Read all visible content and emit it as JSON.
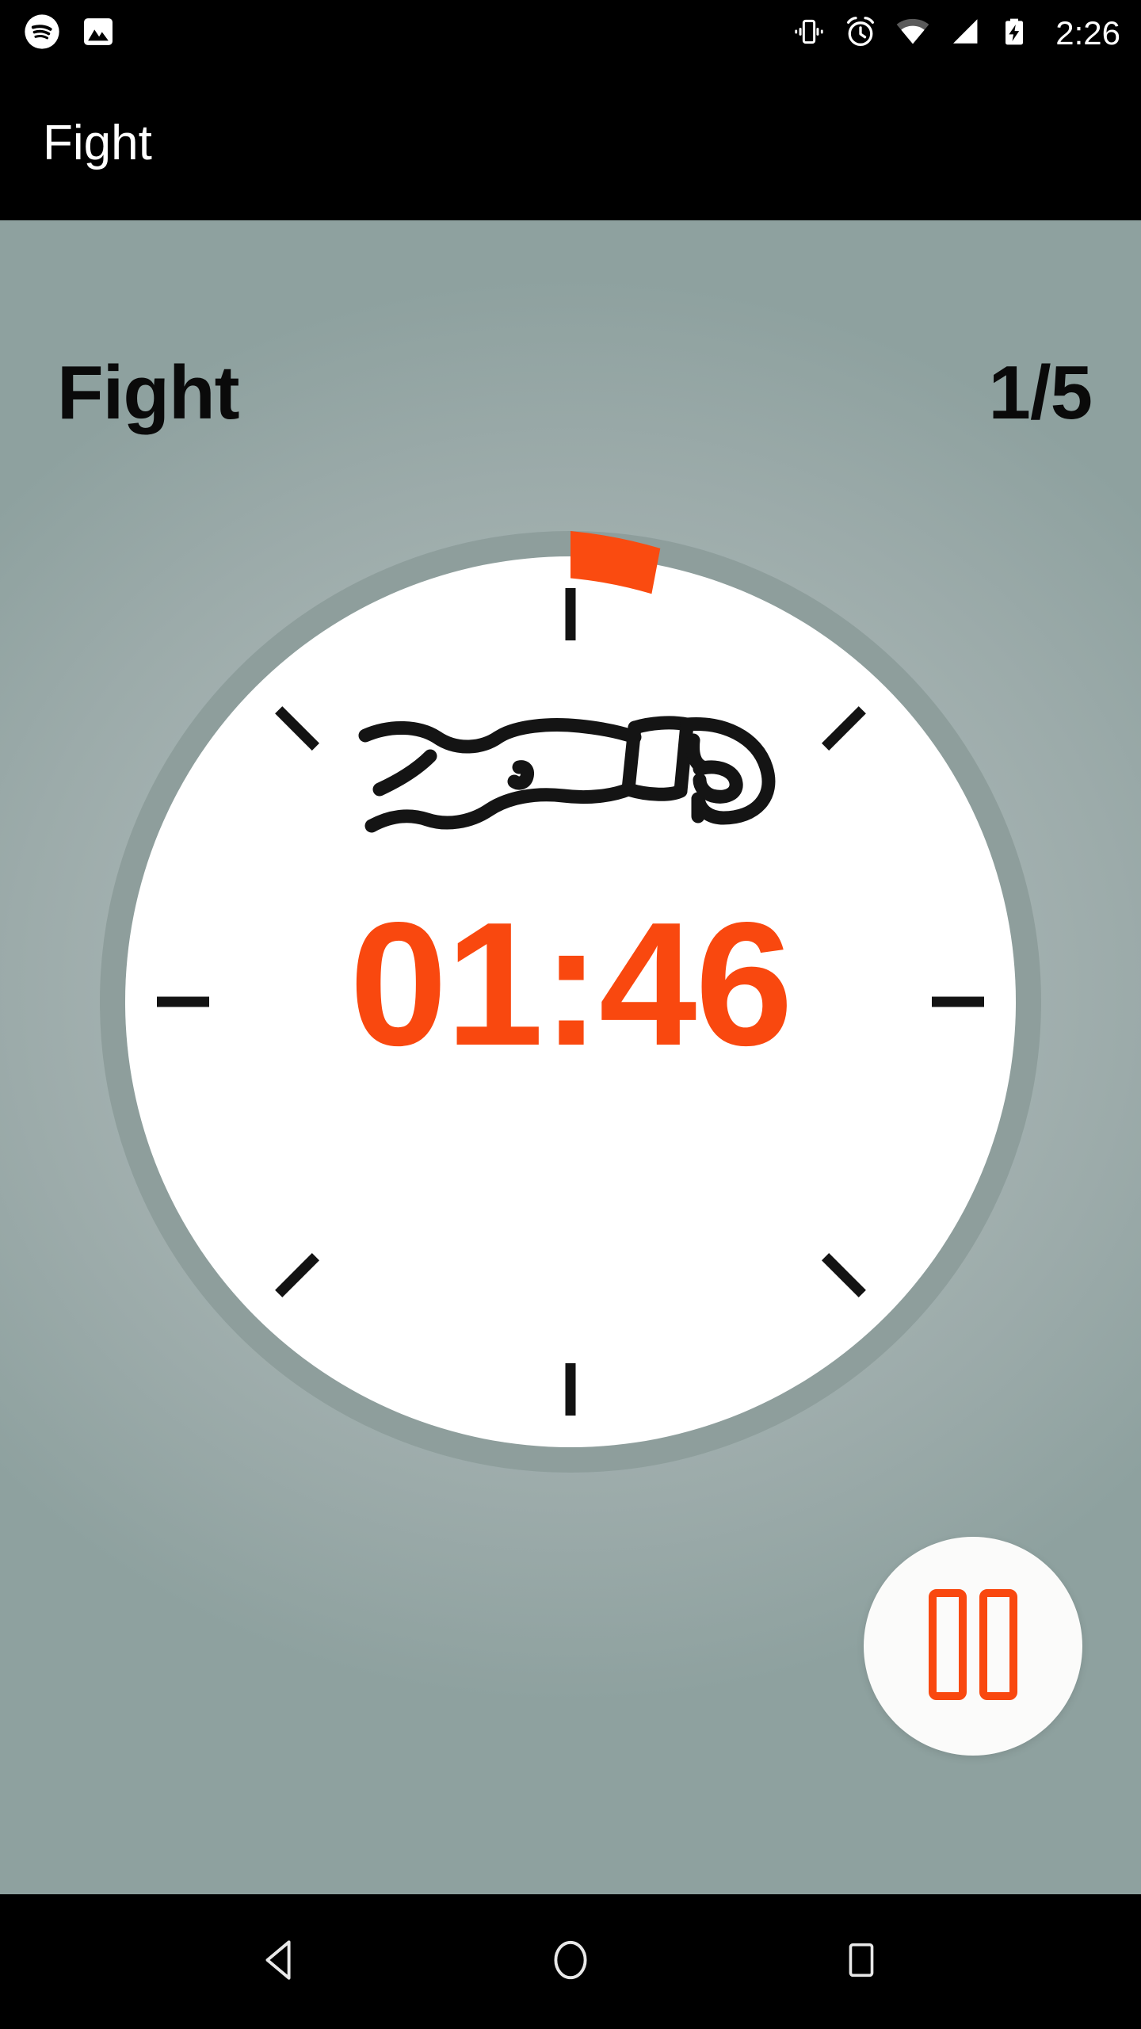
{
  "status_bar": {
    "left_icons": [
      {
        "name": "spotify-icon",
        "label": "Spotify"
      },
      {
        "name": "screenshot-image-icon",
        "label": "Screenshot"
      }
    ],
    "right_icons": [
      {
        "name": "vibrate-mode-icon",
        "label": "Vibrate"
      },
      {
        "name": "alarm-clock-icon",
        "label": "Alarm set"
      },
      {
        "name": "wifi-icon",
        "label": "Wi-Fi"
      },
      {
        "name": "cellular-signal-icon",
        "label": "Signal"
      },
      {
        "name": "battery-charging-icon",
        "label": "Charging"
      }
    ],
    "clock": "2:26",
    "background": "#000000",
    "foreground": "#ffffff"
  },
  "app_bar": {
    "title": "Fight",
    "background": "#000000",
    "title_color": "#ffffff"
  },
  "workout": {
    "phase_label": "Fight",
    "round_counter": "1/5",
    "round_current": 1,
    "round_total": 5,
    "text_color": "#0a0a0a"
  },
  "timer": {
    "display": "01:46",
    "minutes": "01",
    "seconds": "46",
    "remaining_seconds": 106,
    "text_color": "#f9480f",
    "face_color": "#ffffff",
    "ring_color": "#8e9e9c",
    "progress_color": "#fa4b10",
    "progress_start_deg": 0,
    "progress_sweep_deg": 11,
    "tick_count": 8,
    "tick_color": "#131313",
    "center_icon": "boxing-glove-icon"
  },
  "controls": {
    "pause_button": {
      "name": "pause-button",
      "label": "Pause",
      "icon": "pause-icon",
      "background": "#fbfbfa",
      "icon_color": "#f9480f"
    }
  },
  "background": {
    "center_color": "#b2bebd",
    "edge_color": "#8ea19f"
  },
  "nav_bar": {
    "background": "#000000",
    "buttons": [
      {
        "name": "nav-back-button",
        "icon": "back-triangle-icon",
        "label": "Back"
      },
      {
        "name": "nav-home-button",
        "icon": "home-circle-icon",
        "label": "Home"
      },
      {
        "name": "nav-recents-button",
        "icon": "recents-square-icon",
        "label": "Recents"
      }
    ]
  }
}
